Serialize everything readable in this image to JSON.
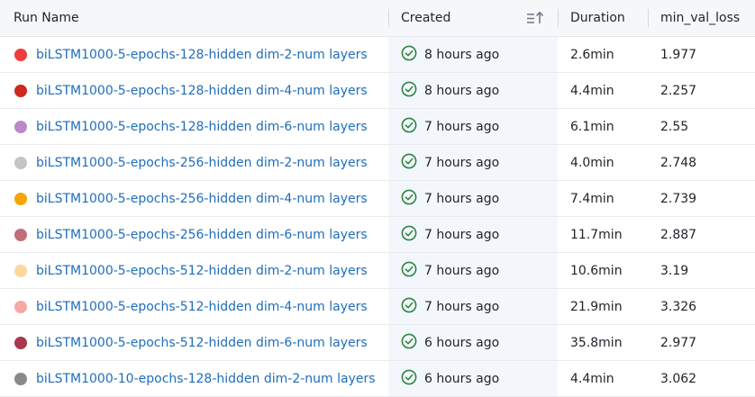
{
  "header": {
    "run_name": "Run Name",
    "created": "Created",
    "duration": "Duration",
    "metric": "min_val_loss"
  },
  "icons": {
    "sort": "sort-ascending-icon",
    "status": "check-circle-icon"
  },
  "colors": {
    "link": "#1f6dbd",
    "check": "#2e8540"
  },
  "runs": [
    {
      "name": "biLSTM1000-5-epochs-128-hidden dim-2-num layers",
      "color": "#f03c3c",
      "created": "8 hours ago",
      "duration": "2.6min",
      "min_val_loss": "1.977"
    },
    {
      "name": "biLSTM1000-5-epochs-128-hidden dim-4-num layers",
      "color": "#cd2a1d",
      "created": "8 hours ago",
      "duration": "4.4min",
      "min_val_loss": "2.257"
    },
    {
      "name": "biLSTM1000-5-epochs-128-hidden dim-6-num layers",
      "color": "#b98ac6",
      "created": "7 hours ago",
      "duration": "6.1min",
      "min_val_loss": "2.55"
    },
    {
      "name": "biLSTM1000-5-epochs-256-hidden dim-2-num layers",
      "color": "#c4c4c4",
      "created": "7 hours ago",
      "duration": "4.0min",
      "min_val_loss": "2.748"
    },
    {
      "name": "biLSTM1000-5-epochs-256-hidden dim-4-num layers",
      "color": "#f5a505",
      "created": "7 hours ago",
      "duration": "7.4min",
      "min_val_loss": "2.739"
    },
    {
      "name": "biLSTM1000-5-epochs-256-hidden dim-6-num layers",
      "color": "#c26d7a",
      "created": "7 hours ago",
      "duration": "11.7min",
      "min_val_loss": "2.887"
    },
    {
      "name": "biLSTM1000-5-epochs-512-hidden dim-2-num layers",
      "color": "#fbd99a",
      "created": "7 hours ago",
      "duration": "10.6min",
      "min_val_loss": "3.19"
    },
    {
      "name": "biLSTM1000-5-epochs-512-hidden dim-4-num layers",
      "color": "#f6a8a6",
      "created": "7 hours ago",
      "duration": "21.9min",
      "min_val_loss": "3.326"
    },
    {
      "name": "biLSTM1000-5-epochs-512-hidden dim-6-num layers",
      "color": "#a8394e",
      "created": "6 hours ago",
      "duration": "35.8min",
      "min_val_loss": "2.977"
    },
    {
      "name": "biLSTM1000-10-epochs-128-hidden dim-2-num layers",
      "color": "#8a8a8a",
      "created": "6 hours ago",
      "duration": "4.4min",
      "min_val_loss": "3.062"
    }
  ]
}
